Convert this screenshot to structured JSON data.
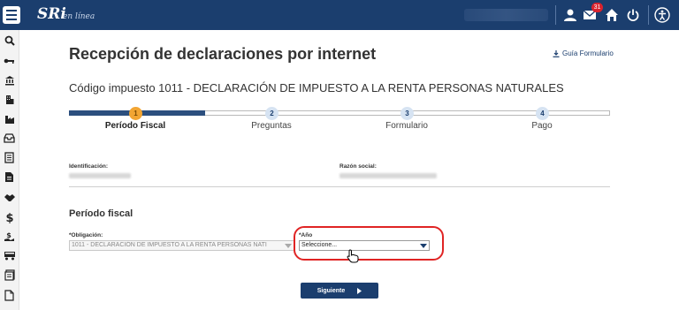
{
  "header": {
    "brand": "SRi",
    "brand_sub": "en línea",
    "mail_count": "31",
    "icons": [
      "user-icon",
      "mail-icon",
      "home-icon",
      "power-icon",
      "accessibility-icon"
    ]
  },
  "sidebar": {
    "icons": [
      "search-icon",
      "key-icon",
      "bank-icon",
      "building-icon",
      "factory-icon",
      "inbox-icon",
      "document-icon",
      "file-icon",
      "handshake-icon",
      "dollar-icon",
      "money-hand-icon",
      "car-icon",
      "stack-icon",
      "page-icon"
    ]
  },
  "page": {
    "title": "Recepción de declaraciones por internet",
    "guide_link": "Guía Formulario",
    "subtitle": "Código impuesto 1011 - DECLARACIÓN DE IMPUESTO A LA RENTA PERSONAS NATURALES"
  },
  "steps": [
    {
      "number": "1",
      "label": "Período Fiscal",
      "active": true
    },
    {
      "number": "2",
      "label": "Preguntas",
      "active": false
    },
    {
      "number": "3",
      "label": "Formulario",
      "active": false
    },
    {
      "number": "4",
      "label": "Pago",
      "active": false
    }
  ],
  "identification": {
    "id_label": "Identificación:",
    "name_label": "Razón social:"
  },
  "fiscal": {
    "section_title": "Período fiscal",
    "obligation_label": "*Obligación:",
    "obligation_value": "1011 - DECLARACIÓN DE IMPUESTO A LA RENTA PERSONAS NATI",
    "year_label": "*Año",
    "year_value": "Seleccione..."
  },
  "actions": {
    "next_label": "Siguiente"
  },
  "colors": {
    "header_bg": "#1b3e6e",
    "active_step": "#f2a533",
    "highlight": "#e02424"
  }
}
